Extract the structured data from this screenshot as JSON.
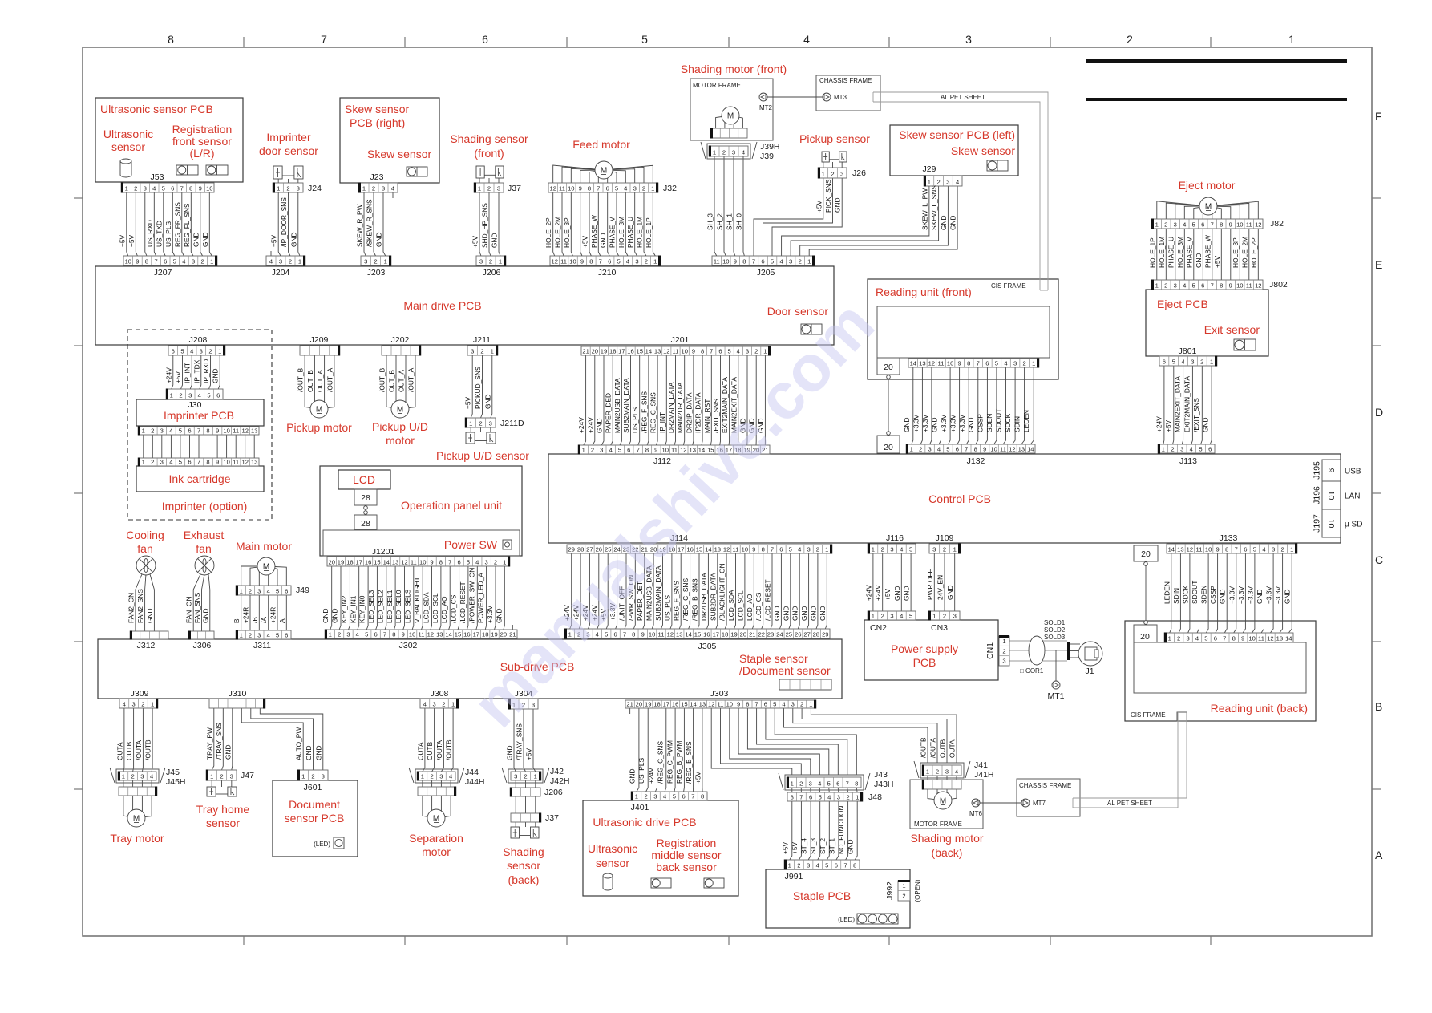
{
  "sheet": {
    "columns": [
      "8",
      "7",
      "6",
      "5",
      "4",
      "3",
      "2",
      "1"
    ],
    "rows": [
      "F",
      "E",
      "D",
      "C",
      "B",
      "A"
    ],
    "watermark": "manualshive.com"
  },
  "titles": {
    "ultrasonic_pcb": "Ultrasonic sensor PCB",
    "ultrasonic_sensor": [
      "Ultrasonic",
      "sensor"
    ],
    "reg_front_sensor": [
      "Registration",
      "front sensor",
      "(L/R)"
    ],
    "imprinter_door_sensor": [
      "Imprinter",
      "door sensor"
    ],
    "skew_r_pcb": [
      "Skew sensor",
      "PCB (right)"
    ],
    "skew_r_sensor": "Skew sensor",
    "shading_sensor_front": [
      "Shading sensor",
      "(front)"
    ],
    "feed_motor": "Feed motor",
    "shading_motor_front": "Shading motor (front)",
    "pickup_sensor": "Pickup sensor",
    "skew_l_pcb": "Skew sensor PCB (left)",
    "skew_l_sensor": "Skew sensor",
    "eject_motor": "Eject motor",
    "eject_pcb": "Eject PCB",
    "exit_sensor": "Exit sensor",
    "main_drive_pcb": "Main drive PCB",
    "door_sensor": "Door sensor",
    "reading_front": "Reading unit (front)",
    "imprinter_pcb": "Imprinter PCB",
    "ink_cartridge": "Ink cartridge",
    "imprinter_option": "Imprinter (option)",
    "pickup_motor": "Pickup motor",
    "pickup_ud_motor": [
      "Pickup U/D",
      "motor"
    ],
    "pickup_ud_sensor": "Pickup U/D sensor",
    "lcd": "LCD",
    "operation_panel": "Operation panel unit",
    "power_sw": "Power SW",
    "control_pcb": "Control PCB",
    "cooling_fan": [
      "Cooling",
      "fan"
    ],
    "exhaust_fan": [
      "Exhaust",
      "fan"
    ],
    "main_motor": "Main motor",
    "sub_drive_pcb": "Sub-drive PCB",
    "staple_doc_sensor": [
      "Staple sensor",
      "/Document sensor"
    ],
    "power_supply": [
      "Power supply",
      "PCB"
    ],
    "reading_back": "Reading unit (back)",
    "tray_motor": "Tray motor",
    "tray_home_sensor": [
      "Tray home",
      "sensor"
    ],
    "doc_sensor_pcb": [
      "Document",
      "sensor PCB"
    ],
    "separation_motor": [
      "Separation",
      "motor"
    ],
    "shading_sensor_back": [
      "Shading",
      "sensor",
      "(back)"
    ],
    "us_drive_pcb": "Ultrasonic drive PCB",
    "us_drive_sensor": [
      "Ultrasonic",
      "sensor"
    ],
    "reg_middle_back_sensor": [
      "Registration",
      "middle sensor",
      "back sensor"
    ],
    "shading_motor_back": [
      "Shading motor",
      "(back)"
    ],
    "staple_pcb": "Staple PCB"
  },
  "notes": {
    "motor_frame": "MOTOR FRAME",
    "chassis_frame": "CHASSIS FRAME",
    "cis_frame": "CIS FRAME",
    "al_pet_sheet": "AL PET SHEET",
    "mt1": "MT1",
    "mt2": "MT2",
    "mt3": "MT3",
    "mt6": "MT6",
    "mt7": "MT7",
    "cor1": "□ COR1",
    "sold": [
      "SOLD1",
      "SOLD2",
      "SOLD3"
    ],
    "j1": "J1",
    "cn1": "CN1",
    "j992": "J992",
    "led": "(LED)",
    "open": "(OPEN)",
    "motor_glyph": "M",
    "cis_pins": "20",
    "lcd_pins": "28",
    "ports": [
      {
        "conn": "J195",
        "pins": "9",
        "name": "USB"
      },
      {
        "conn": "J196",
        "pins": "10",
        "name": "LAN"
      },
      {
        "conn": "J197",
        "pins": "10",
        "name": "μ SD"
      }
    ]
  },
  "connectors": {
    "J53": {
      "labels": [
        "J53"
      ],
      "pins": [
        "1",
        "2",
        "3",
        "4",
        "5",
        "6",
        "7",
        "8",
        "9",
        "10"
      ]
    },
    "J207": {
      "labels": [
        "J207"
      ],
      "pins": [
        "10",
        "9",
        "8",
        "7",
        "6",
        "5",
        "4",
        "3",
        "2",
        "1"
      ]
    },
    "J24": {
      "labels": [
        "J24"
      ],
      "pins": [
        "1",
        "2",
        "3"
      ]
    },
    "J204": {
      "labels": [
        "J204"
      ],
      "pins": [
        "4",
        "3",
        "2",
        "1"
      ]
    },
    "J23": {
      "labels": [
        "J23"
      ],
      "pins": [
        "1",
        "2",
        "3",
        "4"
      ]
    },
    "J203": {
      "labels": [
        "J203"
      ],
      "pins": [
        "3",
        "2",
        "1"
      ]
    },
    "J37F": {
      "labels": [
        "J37"
      ],
      "pins": [
        "1",
        "2",
        "3"
      ]
    },
    "J206M": {
      "labels": [
        "J206"
      ],
      "pins": [
        "3",
        "2",
        "1"
      ]
    },
    "J32": {
      "labels": [
        "J32"
      ],
      "pins": [
        "12",
        "11",
        "10",
        "9",
        "8",
        "7",
        "6",
        "5",
        "4",
        "3",
        "2",
        "1"
      ]
    },
    "J210": {
      "labels": [
        "J210"
      ],
      "pins": [
        "12",
        "11",
        "10",
        "9",
        "8",
        "7",
        "6",
        "5",
        "4",
        "3",
        "2",
        "1"
      ]
    },
    "J39": {
      "labels": [
        "J39H",
        "J39"
      ],
      "pins": [
        "1",
        "2",
        "3",
        "4"
      ]
    },
    "J26": {
      "labels": [
        "J26"
      ],
      "pins": [
        "1",
        "2",
        "3"
      ]
    },
    "J29": {
      "labels": [
        "J29"
      ],
      "pins": [
        "1",
        "2",
        "3",
        "4"
      ]
    },
    "J205": {
      "labels": [
        "J205"
      ],
      "pins": [
        "11",
        "10",
        "9",
        "8",
        "7",
        "6",
        "5",
        "4",
        "3",
        "2",
        "1"
      ]
    },
    "J82": {
      "labels": [
        "J82"
      ],
      "pins": [
        "1",
        "2",
        "3",
        "4",
        "5",
        "6",
        "7",
        "8",
        "9",
        "10",
        "11",
        "12"
      ]
    },
    "J802": {
      "labels": [
        "J802"
      ],
      "pins": [
        "1",
        "2",
        "3",
        "4",
        "5",
        "6",
        "7",
        "8",
        "9",
        "10",
        "11",
        "12"
      ]
    },
    "J801": {
      "labels": [
        "J801"
      ],
      "pins": [
        "6",
        "5",
        "4",
        "3",
        "2",
        "1"
      ]
    },
    "J208": {
      "labels": [
        "J208"
      ],
      "pins": [
        "6",
        "5",
        "4",
        "3",
        "2",
        "1"
      ]
    },
    "J30": {
      "labels": [
        "J30"
      ],
      "pins": [
        "1",
        "2",
        "3",
        "4",
        "5",
        "6"
      ]
    },
    "IMP13": {
      "labels": [],
      "pins": [
        "1",
        "2",
        "3",
        "4",
        "5",
        "6",
        "7",
        "8",
        "9",
        "10",
        "11",
        "12",
        "13"
      ]
    },
    "INK13": {
      "labels": [],
      "pins": [
        "1",
        "2",
        "3",
        "4",
        "5",
        "6",
        "7",
        "8",
        "9",
        "10",
        "11",
        "12",
        "13"
      ]
    },
    "J209": {
      "labels": [
        "J209"
      ]
    },
    "J202": {
      "labels": [
        "J202"
      ]
    },
    "J211": {
      "labels": [
        "J211"
      ],
      "pins": [
        "3",
        "2",
        "1"
      ]
    },
    "J211D": {
      "labels": [
        "J211D"
      ],
      "pins": [
        "1",
        "2",
        "3"
      ]
    },
    "J201": {
      "labels": [
        "J201"
      ],
      "pins": [
        "21",
        "20",
        "19",
        "18",
        "17",
        "16",
        "15",
        "14",
        "13",
        "12",
        "11",
        "10",
        "9",
        "8",
        "7",
        "6",
        "5",
        "4",
        "3",
        "2",
        "1"
      ]
    },
    "RUF14": {
      "labels": [],
      "pins": [
        "14",
        "13",
        "12",
        "11",
        "10",
        "9",
        "8",
        "7",
        "6",
        "5",
        "4",
        "3",
        "2",
        "1"
      ]
    },
    "J112": {
      "labels": [
        "J112"
      ],
      "pins": [
        "1",
        "2",
        "3",
        "4",
        "5",
        "6",
        "7",
        "8",
        "9",
        "10",
        "11",
        "12",
        "13",
        "14",
        "15",
        "16",
        "17",
        "18",
        "19",
        "20",
        "21"
      ]
    },
    "J132": {
      "labels": [
        "J132"
      ],
      "pins": [
        "1",
        "2",
        "3",
        "4",
        "5",
        "6",
        "7",
        "8",
        "9",
        "10",
        "11",
        "12",
        "13",
        "14"
      ]
    },
    "J113": {
      "labels": [
        "J113"
      ],
      "pins": [
        "1",
        "2",
        "3",
        "4",
        "5",
        "6"
      ]
    },
    "J114": {
      "labels": [
        "J114"
      ],
      "pins": [
        "29",
        "28",
        "27",
        "26",
        "25",
        "24",
        "23",
        "22",
        "21",
        "20",
        "19",
        "18",
        "17",
        "16",
        "15",
        "14",
        "13",
        "12",
        "11",
        "10",
        "9",
        "8",
        "7",
        "6",
        "5",
        "4",
        "3",
        "2",
        "1"
      ]
    },
    "J116": {
      "labels": [
        "J116"
      ],
      "pins": [
        "1",
        "2",
        "3",
        "4",
        "5"
      ]
    },
    "J109": {
      "labels": [
        "J109"
      ],
      "pins": [
        "3",
        "2",
        "1"
      ]
    },
    "J133": {
      "labels": [
        "J133"
      ],
      "pins": [
        "14",
        "13",
        "12",
        "11",
        "10",
        "9",
        "8",
        "7",
        "6",
        "5",
        "4",
        "3",
        "2",
        "1"
      ]
    },
    "CN2": {
      "labels": [
        "CN2"
      ],
      "pins": [
        "1",
        "2",
        "3",
        "4",
        "5"
      ]
    },
    "CN3": {
      "labels": [
        "CN3"
      ],
      "pins": [
        "1",
        "2",
        "3"
      ]
    },
    "RUB14": {
      "labels": [],
      "pins": [
        "1",
        "2",
        "3",
        "4",
        "5",
        "6",
        "7",
        "8",
        "9",
        "10",
        "11",
        "12",
        "13",
        "14"
      ]
    },
    "J1201": {
      "labels": [
        "J1201"
      ],
      "pins": [
        "20",
        "19",
        "18",
        "17",
        "16",
        "15",
        "14",
        "13",
        "12",
        "11",
        "10",
        "9",
        "8",
        "7",
        "6",
        "5",
        "4",
        "3",
        "2",
        "1"
      ]
    },
    "J302": {
      "labels": [
        "J302"
      ],
      "pins": [
        "1",
        "2",
        "3",
        "4",
        "5",
        "6",
        "7",
        "8",
        "9",
        "10",
        "11",
        "12",
        "13",
        "14",
        "15",
        "16",
        "17",
        "18",
        "19",
        "20",
        "21"
      ]
    },
    "J49": {
      "labels": [
        "J49"
      ],
      "pins": [
        "1",
        "2",
        "3",
        "4",
        "5",
        "6"
      ]
    },
    "J311": {
      "labels": [
        "J311"
      ],
      "pins": [
        "1",
        "2",
        "3",
        "4",
        "5",
        "6"
      ]
    },
    "J312": {
      "labels": [
        "J312"
      ]
    },
    "J306": {
      "labels": [
        "J306"
      ]
    },
    "J305": {
      "labels": [
        "J305"
      ],
      "pins": [
        "1",
        "2",
        "3",
        "4",
        "5",
        "6",
        "7",
        "8",
        "9",
        "10",
        "11",
        "12",
        "13",
        "14",
        "15",
        "16",
        "17",
        "18",
        "19",
        "20",
        "21",
        "22",
        "23",
        "24",
        "25",
        "26",
        "27",
        "28",
        "29"
      ]
    },
    "J309": {
      "labels": [
        "J309"
      ],
      "pins": [
        "4",
        "3",
        "2",
        "1"
      ]
    },
    "J310": {
      "labels": [
        "J310"
      ]
    },
    "J308": {
      "labels": [
        "J308"
      ],
      "pins": [
        "4",
        "3",
        "2",
        "1"
      ]
    },
    "J304": {
      "labels": [
        "J304"
      ],
      "pins": [
        "1",
        "2",
        "3"
      ]
    },
    "J303": {
      "labels": [
        "J303"
      ],
      "pins": [
        "21",
        "20",
        "19",
        "18",
        "17",
        "16",
        "15",
        "14",
        "13",
        "12",
        "11",
        "10",
        "9",
        "8",
        "7",
        "6",
        "5",
        "4",
        "3",
        "2",
        "1"
      ]
    },
    "J45": {
      "labels": [
        "J45",
        "J45H"
      ],
      "pins": [
        "1",
        "2",
        "3",
        "4"
      ]
    },
    "J47": {
      "labels": [
        "J47"
      ],
      "pins": [
        "1",
        "2",
        "3"
      ]
    },
    "J601": {
      "labels": [
        "J601"
      ],
      "pins": [
        "1",
        "2",
        "3"
      ]
    },
    "J44": {
      "labels": [
        "J44",
        "J44H"
      ],
      "pins": [
        "1",
        "2",
        "3",
        "4"
      ]
    },
    "J42": {
      "labels": [
        "J42",
        "J42H"
      ],
      "pins": [
        "3",
        "2",
        "1"
      ]
    },
    "J206B": {
      "labels": [
        "J206"
      ]
    },
    "J37B": {
      "labels": [
        "J37"
      ]
    },
    "J401": {
      "labels": [
        "J401"
      ],
      "pins": [
        "1",
        "2",
        "3",
        "4",
        "5",
        "6",
        "7",
        "8"
      ]
    },
    "J43": {
      "labels": [
        "J43",
        "J43H"
      ],
      "pins": [
        "1",
        "2",
        "3",
        "4",
        "5",
        "6",
        "7",
        "8"
      ]
    },
    "J48": {
      "labels": [
        "J48"
      ],
      "pins": [
        "8",
        "7",
        "6",
        "5",
        "4",
        "3",
        "2",
        "1"
      ]
    },
    "J991": {
      "labels": [
        "J991"
      ],
      "pins": [
        "1",
        "2",
        "3",
        "4",
        "5",
        "6",
        "7",
        "8"
      ]
    },
    "J41": {
      "labels": [
        "J41",
        "J41H"
      ],
      "pins": [
        "1",
        "2",
        "3",
        "4"
      ]
    },
    "CN1": {
      "pins": [
        "1",
        "2",
        "3"
      ]
    },
    "J992": {
      "pins": [
        "1",
        "2"
      ]
    }
  },
  "signals": {
    "J53": [
      "+5V",
      "+5V",
      "",
      "US_RXD",
      "US_TXD",
      "US_PLS",
      "REG_FR_SNS",
      "REG_FL_SNS",
      "GND",
      "GND"
    ],
    "J24": [
      "+5V",
      "/IP_DOOR_SNS",
      "GND"
    ],
    "J23": [
      "SKEW_R_PW",
      "/SKEW_R_SNS",
      "GND"
    ],
    "J37F": [
      "+5V",
      "SHD_HP_SNS",
      "GND"
    ],
    "J32": [
      "HOLE_2P",
      "HOLE_2M",
      "HOLE_3P",
      "",
      "+5V",
      "PHASE_W",
      "GND",
      "PHASE_V",
      "HOLE_3M",
      "PHASE_U",
      "HOLE_1M",
      "HOLE_1P"
    ],
    "J39": [
      "SH_3",
      "SH_2",
      "SH_1",
      "SH_0"
    ],
    "J26": [
      "+5V",
      "PICK_SNS",
      "GND"
    ],
    "J29": [
      "SKEW_L_PW",
      "SKEW_L_SNS",
      "GND",
      "GND"
    ],
    "J82": [
      "HOLE_1P",
      "HOLE_1M",
      "PHASE_U",
      "HOLE_3M",
      "PHASE_V",
      "GND",
      "PHASE_W",
      "+5V",
      "",
      "HOLE_3P",
      "HOLE_2M",
      "HOLE_2P"
    ],
    "J208": [
      "+24V",
      "+5V",
      "IP_INT",
      "IP_TDX",
      "IP_RXD",
      "GND"
    ],
    "J209": [
      "/OUT_B",
      "OUT_B",
      "OUT_A",
      "/OUT_A"
    ],
    "J202": [
      "/OUT_B",
      "OUT_B",
      "OUT_A",
      "/OUT_A"
    ],
    "J211": [
      "+5V",
      "PICKUD_SNS",
      "GND"
    ],
    "J201": [
      "+24V",
      "+24V",
      "GND",
      "PAPER_DED",
      "MAIN2USB_DATA",
      "SUB2MAIN_DATA",
      "US_PLS",
      "/REG_F_SNS",
      "REG_C_SNS",
      "IP_INT",
      "DR2MAIN_DATA",
      "MAIN2DR_DATA",
      "DR2IP_DATA",
      "IP2DR_DATA",
      "MAIN_RST",
      "/EXIT_SNS",
      "EXIT2MAIN_DATA",
      "MAIN2EXIT_DATA",
      "GND",
      "GND",
      "GND"
    ],
    "J132": [
      "GND",
      "+3.3V",
      "+3.3V",
      "GND",
      "+3.3V",
      "+3.3V",
      "+3.3V",
      "GND",
      "CSSP",
      "SDEN",
      "SDOUT",
      "SDCK",
      "SDIN",
      "LEDEN"
    ],
    "J113": [
      "+24V",
      "+5V",
      "MAIN2EXIT_DATA",
      "EXIT2MAIN_DATA",
      "/EXIT_SNS",
      "GND"
    ],
    "J114": [
      "+24V",
      "+24V",
      "+24V",
      "+24V",
      "+5V",
      "+3.3V",
      "/UNIT_OFF",
      "/PWR_SW_ON",
      "PAPER_DET",
      "MAIN2USB_DATA",
      "SUB2MAIN_DATA",
      "US_PLS",
      "REG_F_SNS",
      "/REG_C_SNS",
      "/REG_B_SNS",
      "DR2USB_DATA",
      "SUB2DR_DATA",
      "/BLACKLIGHT_ON",
      "LCD_SDA",
      "LCD_SCL",
      "LCD_AO",
      "/LCD_CS",
      "/LCD_RESET",
      "GND",
      "GND",
      "GND",
      "GND",
      "GND",
      "GND"
    ],
    "J302": [
      "GND",
      "GND",
      "KEY_IN2",
      "KEY_IN1",
      "KEY_IN0",
      "LED_SEL3",
      "LED_SEL2",
      "LED_SEL1",
      "LED_SEL0",
      "LED_SELS",
      "V_BACKLIGHT",
      "LCD_SDA",
      "LCD_SCL",
      "LCD_AO",
      "/LCD_CS",
      "/LCD_RESET",
      "/POWER_SW_ON",
      "POWER_LED_A",
      "+3.3V",
      "GND"
    ],
    "J116": [
      "+24V",
      "+24V",
      "+5V",
      "GND",
      "GND"
    ],
    "J109": [
      "PWR OFF",
      "24V_EN",
      "GND"
    ],
    "J133": [
      "LEDEN",
      "SDIN",
      "SDCK",
      "SDOUT",
      "SDEN",
      "CSSP",
      "GND",
      "+3.3V",
      "+3.3V",
      "+3.3V",
      "GND",
      "+3.3V",
      "+3.3V",
      "GND"
    ],
    "J312": [
      "FAN2_ON",
      "FAN2_SNS",
      "GND"
    ],
    "J306": [
      "FAN_ON",
      "FAN_SNS",
      "GND"
    ],
    "J49": [
      "B",
      "+24R",
      "/B",
      "/A",
      "+24R",
      "A"
    ],
    "J309": [
      "OUTA",
      "OUTB",
      "/OUTA",
      "/OUTB"
    ],
    "J310": [
      "TRAY_PW",
      "/TRAY_SNS",
      "GND"
    ],
    "J601": [
      "AUTO_PW",
      "GND",
      "GND"
    ],
    "J308": [
      "OUTA",
      "OUTB",
      "/OUTA",
      "/OUTB"
    ],
    "J304": [
      "GND",
      "/TRAY_SNS",
      "+5V"
    ],
    "J401": [
      "GND",
      "US_PLS",
      "+24V",
      "/REG_C_SNS",
      "REG_C_PWM",
      "REG_B_PWM",
      "/REG_B_SNS",
      "+5V"
    ],
    "J41": [
      "/OUTB",
      "/OUTA",
      "OUTB",
      "OUTA"
    ],
    "J991": [
      "+5V",
      "+5V",
      "ST_4",
      "ST_3",
      "ST_2",
      "ST_1",
      "NO_FUNCTION",
      "GND"
    ]
  }
}
